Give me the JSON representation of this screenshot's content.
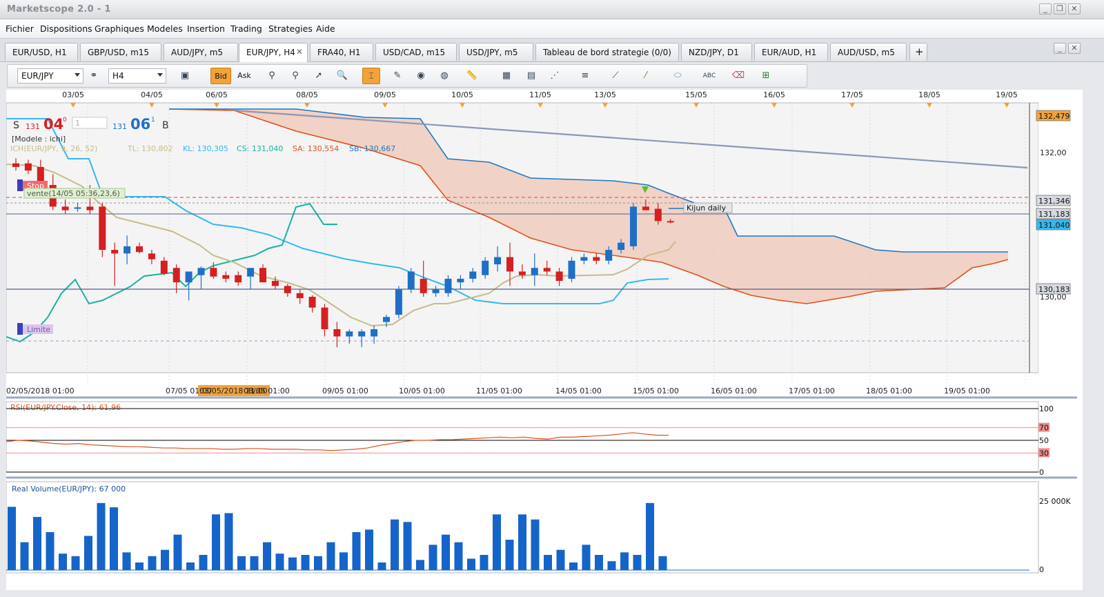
{
  "window": {
    "title": "Marketscope 2.0 - 1"
  },
  "menu": [
    "Fichier",
    "Dispositions",
    "Graphiques",
    "Modeles",
    "Insertion",
    "Trading",
    "Strategies",
    "Aide"
  ],
  "tabs": [
    {
      "label": "EUR/USD, H1",
      "active": false
    },
    {
      "label": "GBP/USD, m15",
      "active": false
    },
    {
      "label": "AUD/JPY, m5",
      "active": false
    },
    {
      "label": "EUR/JPY, H4",
      "active": true
    },
    {
      "label": "FRA40, H1",
      "active": false
    },
    {
      "label": "USD/CAD, m15",
      "active": false
    },
    {
      "label": "USD/JPY, m5",
      "active": false
    },
    {
      "label": "Tableau de bord strategie (0/0)",
      "active": false
    },
    {
      "label": "NZD/JPY, D1",
      "active": false
    },
    {
      "label": "EUR/AUD, H1",
      "active": false
    },
    {
      "label": "AUD/USD, m5",
      "active": false
    }
  ],
  "toolbar": {
    "instrument": "EUR/JPY",
    "timeframe": "H4",
    "bid_label": "Bid",
    "ask_label": "Ask",
    "icons": [
      "chart-type-icon",
      "indicator-icon",
      "indicator-list-icon",
      "cursor-icon",
      "zoom-icon",
      "crosshair-icon",
      "note-icon",
      "alert-icon",
      "globe-icon",
      "ruler-icon",
      "image-icon",
      "export-icon",
      "line-tools-icon",
      "hline-icon",
      "fib-icon",
      "trendline-icon",
      "shape-icon",
      "text-icon",
      "eraser-icon",
      "strategy-icon"
    ]
  },
  "colors": {
    "bull": "#1f6fc6",
    "bear": "#d61f1f",
    "tenkan": "#18b3a4",
    "kijun": "#c8bb86",
    "chikou": "#35b8ee",
    "senkou_a": "#e2501b",
    "senkou_b": "#1d78c0",
    "cloud": "#f0c7b6",
    "trend": "#8a97b6",
    "rsi": "#e2501b",
    "volume": "#1564c9"
  },
  "trade": {
    "sell_label": "S",
    "sell_big": "131",
    "sell_pips": "04",
    "sell_sup": "0",
    "qty": "1",
    "buy_big": "131",
    "buy_pips": "06",
    "buy_sup": "1",
    "buy_label": "B"
  },
  "chart": {
    "model_label": "[Modele : ichi]",
    "ichimoku_prefix": "ICH(EUR/JPY, 9, 26, 52)",
    "tl": "TL: 130,802",
    "kl": "KL: 130,305",
    "cs": "CS: 131,040",
    "sa": "SA: 130,554",
    "sb": "SB: 130,667",
    "stop_label": "Stop",
    "limit_label": "Limite",
    "order_label": "vente(14/05 05:36,23,6)",
    "kijun_label": "Kijun daily",
    "top_dates": [
      "03/05",
      "04/05",
      "06/05",
      "08/05",
      "09/05",
      "10/05",
      "11/05",
      "13/05",
      "15/05",
      "16/05",
      "17/05",
      "18/05",
      "19/05"
    ],
    "bottom_dates": [
      "02/05/2018 01:00",
      "03/05/2018 21:00",
      "07/05 01:00",
      "08/05 01:00",
      "09/05 01:00",
      "10/05 01:00",
      "11/05 01:00",
      "14/05 01:00",
      "15/05 01:00",
      "16/05 01:00",
      "17/05 01:00",
      "18/05 01:00",
      "19/05 01:00"
    ],
    "price_tags": [
      "132,479",
      "131,346",
      "131,183",
      "131,040",
      "130,183"
    ],
    "price_axis": [
      "132,00",
      "131,00",
      "130,00"
    ],
    "rsi_label": "RSI(EUR/JPY.Close, 14): 61,96",
    "rsi_axis": [
      "100",
      "70",
      "50",
      "30",
      "0"
    ],
    "volume_label": "Real Volume(EUR/JPY): 67 000",
    "volume_axis": [
      "25 000K",
      "0"
    ]
  },
  "chart_data": {
    "type": "candlestick",
    "instrument": "EUR/JPY",
    "timeframe": "H4",
    "ylim": [
      129.0,
      132.5
    ],
    "candles": [
      {
        "o": 131.85,
        "h": 131.92,
        "l": 131.75,
        "c": 131.8
      },
      {
        "o": 131.85,
        "h": 131.9,
        "l": 131.7,
        "c": 131.75
      },
      {
        "o": 131.8,
        "h": 131.9,
        "l": 131.55,
        "c": 131.6
      },
      {
        "o": 131.55,
        "h": 131.7,
        "l": 131.2,
        "c": 131.25
      },
      {
        "o": 131.25,
        "h": 131.35,
        "l": 131.15,
        "c": 131.2
      },
      {
        "o": 131.22,
        "h": 131.3,
        "l": 131.18,
        "c": 131.24
      },
      {
        "o": 131.25,
        "h": 131.55,
        "l": 131.15,
        "c": 131.2
      },
      {
        "o": 131.25,
        "h": 131.3,
        "l": 130.55,
        "c": 130.65
      },
      {
        "o": 130.65,
        "h": 130.75,
        "l": 130.15,
        "c": 130.6
      },
      {
        "o": 130.6,
        "h": 130.85,
        "l": 130.45,
        "c": 130.7
      },
      {
        "o": 130.7,
        "h": 130.75,
        "l": 130.6,
        "c": 130.62
      },
      {
        "o": 130.6,
        "h": 130.65,
        "l": 130.45,
        "c": 130.52
      },
      {
        "o": 130.5,
        "h": 130.55,
        "l": 130.3,
        "c": 130.32
      },
      {
        "o": 130.4,
        "h": 130.45,
        "l": 130.05,
        "c": 130.2
      },
      {
        "o": 130.2,
        "h": 130.35,
        "l": 129.95,
        "c": 130.35
      },
      {
        "o": 130.3,
        "h": 130.42,
        "l": 130.1,
        "c": 130.4
      },
      {
        "o": 130.4,
        "h": 130.48,
        "l": 130.25,
        "c": 130.28
      },
      {
        "o": 130.3,
        "h": 130.35,
        "l": 130.2,
        "c": 130.25
      },
      {
        "o": 130.3,
        "h": 130.35,
        "l": 130.15,
        "c": 130.2
      },
      {
        "o": 130.28,
        "h": 130.38,
        "l": 130.1,
        "c": 130.4
      },
      {
        "o": 130.4,
        "h": 130.45,
        "l": 130.2,
        "c": 130.2
      },
      {
        "o": 130.22,
        "h": 130.28,
        "l": 130.1,
        "c": 130.15
      },
      {
        "o": 130.15,
        "h": 130.18,
        "l": 130.0,
        "c": 130.05
      },
      {
        "o": 130.05,
        "h": 130.1,
        "l": 129.9,
        "c": 129.98
      },
      {
        "o": 130.0,
        "h": 130.02,
        "l": 129.78,
        "c": 129.85
      },
      {
        "o": 129.85,
        "h": 129.9,
        "l": 129.45,
        "c": 129.55
      },
      {
        "o": 129.55,
        "h": 129.65,
        "l": 129.3,
        "c": 129.45
      },
      {
        "o": 129.45,
        "h": 129.55,
        "l": 129.35,
        "c": 129.52
      },
      {
        "o": 129.45,
        "h": 129.55,
        "l": 129.3,
        "c": 129.52
      },
      {
        "o": 129.45,
        "h": 129.6,
        "l": 129.35,
        "c": 129.55
      },
      {
        "o": 129.65,
        "h": 129.75,
        "l": 129.58,
        "c": 129.72
      },
      {
        "o": 129.75,
        "h": 130.15,
        "l": 129.7,
        "c": 130.1
      },
      {
        "o": 130.1,
        "h": 130.4,
        "l": 130.05,
        "c": 130.35
      },
      {
        "o": 130.25,
        "h": 130.5,
        "l": 130.0,
        "c": 130.05
      },
      {
        "o": 130.05,
        "h": 130.15,
        "l": 130.0,
        "c": 130.1
      },
      {
        "o": 130.05,
        "h": 130.3,
        "l": 130.0,
        "c": 130.25
      },
      {
        "o": 130.2,
        "h": 130.3,
        "l": 130.1,
        "c": 130.25
      },
      {
        "o": 130.25,
        "h": 130.4,
        "l": 130.2,
        "c": 130.35
      },
      {
        "o": 130.3,
        "h": 130.55,
        "l": 130.25,
        "c": 130.5
      },
      {
        "o": 130.45,
        "h": 130.7,
        "l": 130.35,
        "c": 130.55
      },
      {
        "o": 130.55,
        "h": 130.75,
        "l": 130.15,
        "c": 130.35
      },
      {
        "o": 130.35,
        "h": 130.45,
        "l": 130.25,
        "c": 130.3
      },
      {
        "o": 130.3,
        "h": 130.6,
        "l": 130.15,
        "c": 130.4
      },
      {
        "o": 130.4,
        "h": 130.5,
        "l": 130.3,
        "c": 130.35
      },
      {
        "o": 130.35,
        "h": 130.4,
        "l": 130.15,
        "c": 130.22
      },
      {
        "o": 130.25,
        "h": 130.55,
        "l": 130.2,
        "c": 130.5
      },
      {
        "o": 130.5,
        "h": 130.6,
        "l": 130.45,
        "c": 130.55
      },
      {
        "o": 130.55,
        "h": 130.6,
        "l": 130.45,
        "c": 130.5
      },
      {
        "o": 130.5,
        "h": 130.7,
        "l": 130.45,
        "c": 130.65
      },
      {
        "o": 130.65,
        "h": 130.8,
        "l": 130.6,
        "c": 130.75
      },
      {
        "o": 130.7,
        "h": 131.3,
        "l": 130.65,
        "c": 131.25
      },
      {
        "o": 131.25,
        "h": 131.35,
        "l": 131.2,
        "c": 131.2
      },
      {
        "o": 131.22,
        "h": 131.3,
        "l": 131.0,
        "c": 131.05
      },
      {
        "o": 131.05,
        "h": 131.08,
        "l": 131.02,
        "c": 131.04
      }
    ],
    "rsi": {
      "name": "RSI(EUR/JPY.Close, 14)",
      "last": 61.96,
      "levels": [
        70,
        50,
        30
      ],
      "ylim": [
        0,
        100
      ],
      "values": [
        48,
        50,
        49,
        47,
        45,
        44,
        45,
        43,
        42,
        41,
        40,
        40,
        39,
        38,
        38,
        37,
        37,
        37,
        36,
        36,
        37,
        37,
        36,
        36,
        36,
        35,
        35,
        34,
        35,
        36,
        38,
        42,
        45,
        48,
        50,
        50,
        51,
        51,
        52,
        53,
        54,
        55,
        54,
        55,
        53,
        52,
        55,
        55,
        56,
        57,
        58,
        60,
        62,
        60,
        58,
        58
      ]
    },
    "volume": {
      "name": "Real Volume(EUR/JPY)",
      "last": 67000,
      "unit": "K",
      "ylim": [
        0,
        30000
      ],
      "values": [
        25000,
        11000,
        21000,
        15000,
        6500,
        5500,
        13500,
        26500,
        24800,
        7000,
        3000,
        5500,
        8000,
        14000,
        3000,
        6000,
        22000,
        22500,
        5500,
        5500,
        11000,
        6500,
        5000,
        6000,
        5500,
        11000,
        7000,
        15000,
        16000,
        3000,
        20000,
        19000,
        4000,
        10000,
        14000,
        11000,
        4500,
        6000,
        22000,
        12000,
        22000,
        20000,
        6000,
        8000,
        3000,
        10000,
        6000,
        3500,
        7000,
        6000,
        26500,
        5500,
        4500,
        4000,
        9500,
        10000,
        8000,
        8000,
        5500,
        9500,
        8500,
        8500,
        7500,
        3000,
        3000,
        3500,
        7500,
        8000,
        3500,
        6000,
        7000,
        4500,
        3000,
        5500,
        6500,
        22000,
        14000,
        13500
      ]
    }
  }
}
